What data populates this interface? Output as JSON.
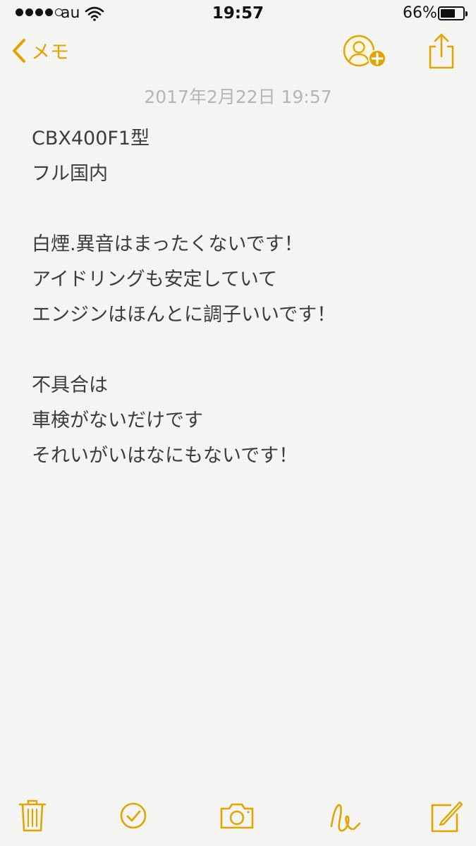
{
  "status_bar": {
    "carrier": "au",
    "time": "19:57",
    "battery_percent": "66%",
    "battery_level": 0.66,
    "signal_bars_filled": 4,
    "signal_bars_total": 5
  },
  "nav": {
    "back_label": "メモ",
    "icons": [
      "chevron-left-icon",
      "add-person-icon",
      "share-icon"
    ]
  },
  "note": {
    "date": "2017年2月22日 19:57",
    "lines": [
      "CBX400F1型",
      "フル国内",
      "",
      "白煙.異音はまったくないです！",
      "アイドリングも安定していて",
      "エンジンはほんとに調子いいです！",
      "",
      "不具合は",
      "車検がないだけです",
      "それいがいはなにもないです！"
    ]
  },
  "toolbar": {
    "icons": [
      "trash-icon",
      "checklist-icon",
      "camera-icon",
      "sketch-icon",
      "compose-icon"
    ]
  },
  "colors": {
    "accent": "#e2a400",
    "text": "#3c3c3c",
    "date": "#b5b5b5",
    "background": "#f6f6f4"
  }
}
